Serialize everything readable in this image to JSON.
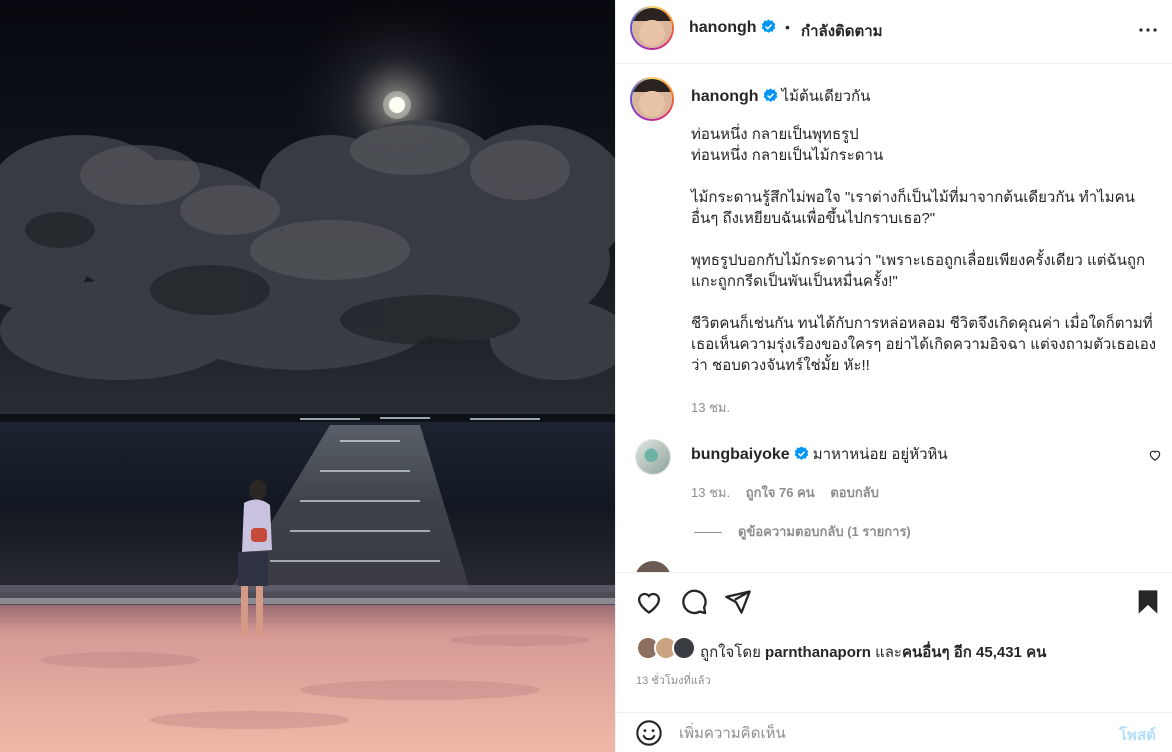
{
  "header": {
    "username": "hanongh",
    "separator": "•",
    "follow_status": "กำลังติดตาม",
    "more_icon": "more-horizontal-icon"
  },
  "caption": {
    "username": "hanongh",
    "title": "ไม้ต้นเดียวกัน",
    "paragraphs": [
      "ท่อนหนึ่ง กลายเป็นพุทธรูป\nท่อนหนึ่ง กลายเป็นไม้กระดาน",
      "ไม้กระดานรู้สึกไม่พอใจ \"เราต่างก็เป็นไม้ที่มาจากต้นเดียวกัน ทำไมคนอื่นๆ ถึงเหยียบฉันเพื่อขึ้นไปกราบเธอ?\"",
      "พุทธรูปบอกกับไม้กระดานว่า \"เพราะเธอถูกเลื่อยเพียงครั้งเดียว แต่ฉันถูกแกะถูกกรีดเป็นพันเป็นหมื่นครั้ง!\"",
      "ชีวิตคนก็เช่นกัน ทนได้กับการหล่อหลอม ชีวิตจึงเกิดคุณค่า เมื่อใดก็ตามที่เธอเห็นความรุ่งเรืองของใครๆ อย่าได้เกิดความอิจฉา แต่จงถามตัวเธอเองว่า ชอบดวงจันทร์ใช่มั้ย หัะ!!"
    ],
    "time": "13 ชม."
  },
  "comment": {
    "username": "bungbaiyoke",
    "text": "มาหาหน่อย อยู่หัวหิน",
    "time": "13 ชม.",
    "likes": "ถูกใจ 76 คน",
    "reply": "ตอบกลับ",
    "view_replies": "ดูข้อความตอบกลับ (1 รายการ)"
  },
  "actions": {
    "icons": [
      "heart-icon",
      "comment-icon",
      "share-icon",
      "bookmark-icon"
    ],
    "liked_by_prefix": "ถูกใจโดย",
    "liked_by_user": "parnthanaporn",
    "liked_by_mid": "และ",
    "liked_by_others": "คนอื่นๆ",
    "liked_by_count": "อีก 45,431 คน",
    "post_time": "13 ชั่วโมงที่แล้ว"
  },
  "add_comment": {
    "placeholder": "เพิ่มความคิดเห็น",
    "post_label": "โพสต์",
    "emoji_icon": "emoji-icon"
  },
  "colors": {
    "verified": "#0095f6",
    "post_button_disabled": "#b2dffc",
    "secondary_text": "#8e8e8e"
  }
}
